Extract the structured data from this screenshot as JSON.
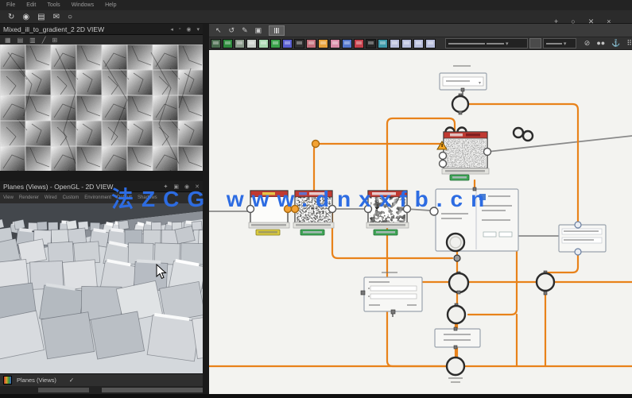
{
  "watermark": {
    "text": "法ZCG www.dnxxfb.cn",
    "color": "#2d6ce2"
  },
  "menubar": {
    "items": [
      "File",
      "Edit",
      "Tools",
      "Windows",
      "Help"
    ]
  },
  "quickbar": {
    "icons": [
      "↻",
      "◉",
      "▤",
      "✉",
      "○"
    ]
  },
  "view2d": {
    "title": "Mixed_ill_to_gradient_2 2D VIEW",
    "window_icons": [
      "◂",
      "▫",
      "◉",
      "▾"
    ],
    "toolbar_icons": [
      "▦",
      "▤",
      "▥",
      "╱",
      "⊞"
    ]
  },
  "view3d": {
    "title": "Planes (Views) - OpenGL - 2D VIEW",
    "window_icons": [
      "✦",
      "▣",
      "◉",
      "✕"
    ],
    "menu_items": [
      "View",
      "Renderer",
      "Wired",
      "Custom",
      "Environment",
      "Default",
      "Shadows"
    ],
    "tab": {
      "label": "Planes (Views)",
      "check": "✓"
    }
  },
  "graph": {
    "window_controls": [
      "+",
      "○",
      "✕",
      "×"
    ],
    "toolbar_icons": [
      "↖",
      "↺",
      "✎",
      "▣"
    ],
    "right_icons": [
      "⊘",
      "●●",
      "⚓",
      "⠿"
    ],
    "palette_colors": [
      "#4a6b4e",
      "#2e8b3d",
      "#8a9a8a",
      "#c9cfc9",
      "#a8d8b0",
      "#3aa24a",
      "#5a5fd0",
      "#303030",
      "#c4707c",
      "#e6a23c",
      "#d98ca8",
      "#5578cc",
      "#c4414c",
      "#262626",
      "#3f9aaa",
      "#b9bfdd",
      "#b9bfdd",
      "#b9bfdd",
      "#b9bfdd"
    ],
    "wire_color": "#e8821a",
    "wire_gray": "#8a8a8a",
    "node_title_color": "#c03a32",
    "badge_green": "#3fa455",
    "badge_yellow": "#d8c93e"
  }
}
